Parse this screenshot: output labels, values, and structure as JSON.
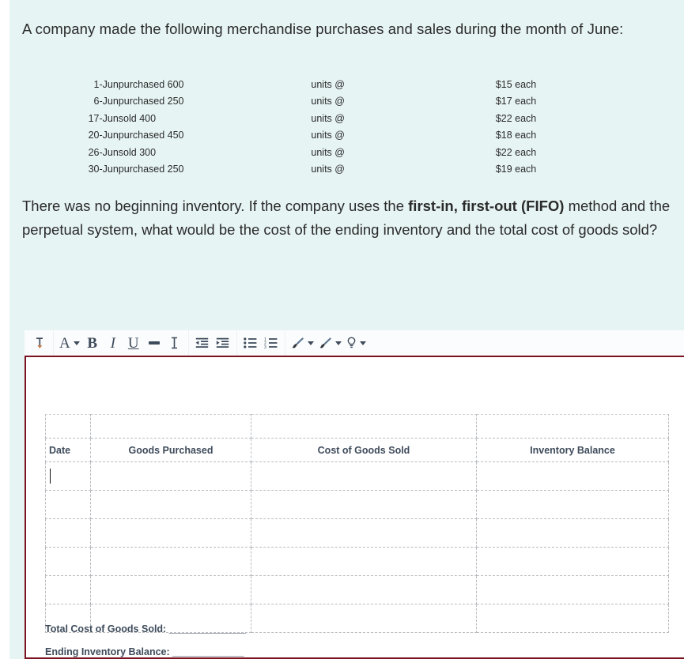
{
  "question": {
    "intro": "A company made the following merchandise purchases and sales during the month of June:",
    "transactions": [
      {
        "date": "1-Jun",
        "description": "purchased 600",
        "units": "units @",
        "price": "$15 each"
      },
      {
        "date": "6-Jun",
        "description": "purchased 250",
        "units": "units @",
        "price": "$17 each"
      },
      {
        "date": "17-Jun",
        "description": "sold 400",
        "units": "units @",
        "price": "$22 each"
      },
      {
        "date": "20-Jun",
        "description": "purchased 450",
        "units": "units @",
        "price": "$18 each"
      },
      {
        "date": "26-Jun",
        "description": "sold 300",
        "units": "units @",
        "price": "$22 each"
      },
      {
        "date": "30-Jun",
        "description": "purchased 250",
        "units": "units @",
        "price": "$19 each"
      }
    ],
    "body_part1": "There was no beginning inventory. If the company uses the ",
    "body_bold1": "first-in, first-out (FIFO)",
    "body_part2": " method and the perpetual system, what would be the cost of the ending inventory and the total cost of goods sold?"
  },
  "editor": {
    "toolbar": {
      "groups": [
        {
          "buttons": [
            {
              "name": "text-direction-icon",
              "label": "⤸",
              "has_caret": false
            }
          ]
        },
        {
          "buttons": [
            {
              "name": "font-family-icon",
              "label": "A",
              "has_caret": true
            },
            {
              "name": "bold-icon",
              "label": "B",
              "has_caret": false
            },
            {
              "name": "italic-icon",
              "label": "I",
              "has_caret": false
            },
            {
              "name": "underline-icon",
              "label": "U",
              "has_caret": false
            },
            {
              "name": "horizontal-rule-icon",
              "label": "—",
              "has_caret": false
            },
            {
              "name": "remove-formatting-icon",
              "label": "I",
              "has_caret": false
            }
          ]
        },
        {
          "buttons": [
            {
              "name": "outdent-icon",
              "label": "≡",
              "has_caret": false
            },
            {
              "name": "indent-icon",
              "label": "≡",
              "has_caret": false
            }
          ]
        },
        {
          "buttons": [
            {
              "name": "bulleted-list-icon",
              "label": "•≡",
              "has_caret": false
            },
            {
              "name": "numbered-list-icon",
              "label": "1≡",
              "has_caret": false
            }
          ]
        },
        {
          "buttons": [
            {
              "name": "text-color-brush-icon",
              "label": "brush",
              "has_caret": true
            },
            {
              "name": "highlight-color-brush-icon",
              "label": "brush",
              "has_caret": true
            },
            {
              "name": "insert-hint-bulb-icon",
              "label": "bulb",
              "has_caret": true
            }
          ]
        }
      ]
    },
    "answer_table": {
      "headers": [
        "Date",
        "Goods Purchased",
        "Cost of Goods Sold",
        "Inventory Balance"
      ],
      "blank_top_row": [
        "",
        "",
        "",
        ""
      ],
      "body_rows": [
        [
          "",
          "",
          "",
          ""
        ],
        [
          "",
          "",
          "",
          ""
        ],
        [
          "",
          "",
          "",
          ""
        ],
        [
          "",
          "",
          "",
          ""
        ],
        [
          "",
          "",
          "",
          ""
        ],
        [
          "",
          "",
          "",
          ""
        ]
      ]
    },
    "totals": {
      "cogs_label": "Total Cost of Goods Sold: ______________",
      "ending_label": "Ending Inventory Balance: _____________"
    },
    "border_color": "#7b1220"
  },
  "colors": {
    "page_background": "#e7f4f4",
    "editor_border": "#7b1220",
    "text": "#2b2b2b",
    "toolbar_icon": "#3e4b5b"
  }
}
